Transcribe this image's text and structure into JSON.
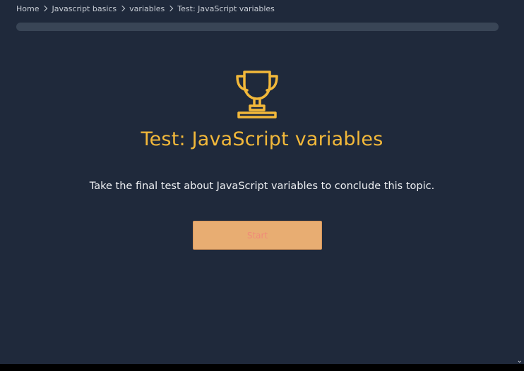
{
  "breadcrumb": {
    "items": [
      "Home",
      "Javascript basics",
      "variables",
      "Test: JavaScript variables"
    ]
  },
  "progress": {
    "value_percent": 0
  },
  "hero": {
    "icon": "trophy-icon",
    "title": "Test: JavaScript variables",
    "description": "Take the final test about JavaScript variables to conclude this topic.",
    "start_label": "Start"
  },
  "colors": {
    "background": "#1f293b",
    "accent": "#f2b83a",
    "button": "#e8ad72"
  }
}
